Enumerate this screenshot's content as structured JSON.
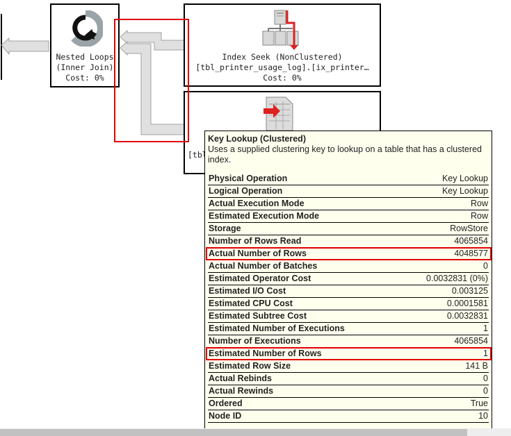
{
  "plan": {
    "operators": [
      {
        "id": "nested-loops",
        "icon": "nested-loops-icon",
        "lines": [
          "Nested Loops",
          "(Inner Join)",
          "Cost: 0%"
        ]
      },
      {
        "id": "index-seek",
        "icon": "index-seek-icon",
        "lines": [
          "Index Seek (NonClustered)",
          "[tbl_printer_usage_log].[ix_printer…",
          "Cost: 0%"
        ]
      },
      {
        "id": "key-lookup",
        "icon": "key-lookup-icon",
        "lines": [
          "[tbl"
        ]
      }
    ]
  },
  "tooltip": {
    "title": "Key Lookup (Clustered)",
    "description": "Uses a supplied clustering key to lookup on a table that has a clustered index.",
    "rows": [
      {
        "key": "Physical Operation",
        "value": "Key Lookup",
        "highlight": false
      },
      {
        "key": "Logical Operation",
        "value": "Key Lookup",
        "highlight": false
      },
      {
        "key": "Actual Execution Mode",
        "value": "Row",
        "highlight": false
      },
      {
        "key": "Estimated Execution Mode",
        "value": "Row",
        "highlight": false
      },
      {
        "key": "Storage",
        "value": "RowStore",
        "highlight": false
      },
      {
        "key": "Number of Rows Read",
        "value": "4065854",
        "highlight": false
      },
      {
        "key": "Actual Number of Rows",
        "value": "4048577",
        "highlight": true
      },
      {
        "key": "Actual Number of Batches",
        "value": "0",
        "highlight": false
      },
      {
        "key": "Estimated Operator Cost",
        "value": "0.0032831 (0%)",
        "highlight": false
      },
      {
        "key": "Estimated I/O Cost",
        "value": "0.003125",
        "highlight": false
      },
      {
        "key": "Estimated CPU Cost",
        "value": "0.0001581",
        "highlight": false
      },
      {
        "key": "Estimated Subtree Cost",
        "value": "0.0032831",
        "highlight": false
      },
      {
        "key": "Estimated Number of Executions",
        "value": "1",
        "highlight": false
      },
      {
        "key": "Number of Executions",
        "value": "4065854",
        "highlight": false
      },
      {
        "key": "Estimated Number of Rows",
        "value": "1",
        "highlight": true
      },
      {
        "key": "Estimated Row Size",
        "value": "141 B",
        "highlight": false
      },
      {
        "key": "Actual Rebinds",
        "value": "0",
        "highlight": false
      },
      {
        "key": "Actual Rewinds",
        "value": "0",
        "highlight": false
      },
      {
        "key": "Ordered",
        "value": "True",
        "highlight": false
      },
      {
        "key": "Node ID",
        "value": "10",
        "highlight": false
      }
    ]
  },
  "colors": {
    "highlight": "#e00000",
    "tooltip_bg": "#ffffee",
    "arrow_fill": "#e0e0e0",
    "arrow_stroke": "#a0a0a0"
  }
}
